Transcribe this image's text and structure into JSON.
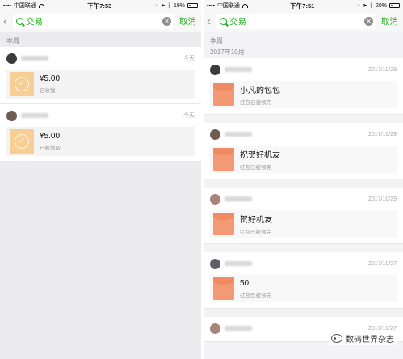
{
  "left": {
    "status": {
      "carrier": "中国联通",
      "time": "下午7:53",
      "battery": "19%",
      "battery_level": 0.19
    },
    "search": {
      "query": "交易",
      "cancel": "取消"
    },
    "section": "本周",
    "items": [
      {
        "date": "今天",
        "amount": "¥5.00",
        "status": "已收钱"
      },
      {
        "date": "今天",
        "amount": "¥5.00",
        "status": "已被领取"
      }
    ]
  },
  "right": {
    "status": {
      "carrier": "中国联通",
      "time": "下午7:51",
      "battery": "20%",
      "battery_level": 0.2
    },
    "search": {
      "query": "交易",
      "cancel": "取消"
    },
    "section": "本周",
    "month": "2017年10月",
    "items": [
      {
        "date": "2017/10/29",
        "title": "小凡的包包",
        "status": "红包已被领完"
      },
      {
        "date": "2017/10/29",
        "title": "祝贺好机友",
        "status": "红包已被领完"
      },
      {
        "date": "2017/10/29",
        "title": "贺好机友",
        "status": "红包已被领完"
      },
      {
        "date": "2017/10/27",
        "title": "50",
        "status": "红包已被领完"
      },
      {
        "date": "2017/10/27"
      }
    ]
  },
  "watermark": "数码世界杂志"
}
